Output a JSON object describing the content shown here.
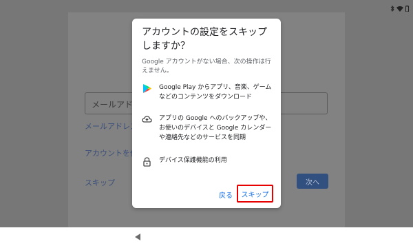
{
  "status_bar": {
    "icons": [
      "bluetooth-icon",
      "wifi-icon",
      "battery-icon"
    ]
  },
  "background": {
    "email_placeholder": "メールアドレ",
    "forgot_email_link": "メールアドレスを",
    "create_account_link": "アカウントを作成",
    "skip_link": "スキップ",
    "next_button": "次へ"
  },
  "dialog": {
    "title": "アカウントの設定をスキップしますか？",
    "description": "Google アカウントがない場合、次の操作は行えません。",
    "features": [
      {
        "icon": "play-store-icon",
        "text": "Google Play からアプリ、音楽、ゲームなどのコンテンツをダウンロード"
      },
      {
        "icon": "cloud-upload-icon",
        "text": "アプリの Google へのバックアップや、お使いのデバイスと Google カレンダーや連絡先などのサービスを同期"
      },
      {
        "icon": "lock-icon",
        "text": "デバイス保護機能の利用"
      }
    ],
    "back_button": "戻る",
    "skip_button": "スキップ"
  },
  "colors": {
    "accent": "#1a73e8",
    "highlight_border": "#e60000",
    "scrim": "#777777"
  }
}
